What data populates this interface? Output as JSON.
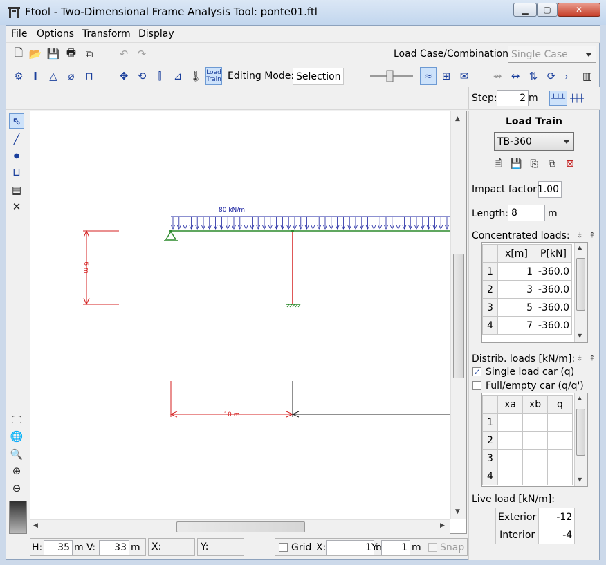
{
  "window": {
    "title": "Ftool - Two-Dimensional Frame Analysis Tool: ponte01.ftl",
    "controls": [
      "minimize-icon",
      "maximize-icon",
      "close-icon"
    ]
  },
  "menu": [
    "File",
    "Options",
    "Transform",
    "Display"
  ],
  "toolbar1": {
    "load_case_label": "Load Case/Combination:",
    "load_case_value": "Single Case"
  },
  "toolbar2": {
    "load_train_btn": [
      "Load",
      "Train"
    ],
    "editing_mode_label": "Editing Mode:",
    "editing_mode_value": "Selection"
  },
  "step": {
    "label": "Step:",
    "value": "2",
    "unit": "m"
  },
  "canvas": {
    "distributed_load_label": "80 kN/m",
    "height_dim_label": "6 m",
    "span_dim_label": "10 m",
    "colors": {
      "load": "#1a22a0",
      "member": "#d42020",
      "dimension": "#d42020",
      "support": "#2c8a2c"
    }
  },
  "status": {
    "h_label": "H:",
    "h_value": "35",
    "h_unit": "m",
    "v_label": "V:",
    "v_value": "33",
    "v_unit": "m",
    "x_label": "X:",
    "y_label": "Y:",
    "grid_label": "Grid",
    "grid_x_label": "X:",
    "grid_x_value": "1",
    "grid_x_unit": "m",
    "grid_y_label": "Y:",
    "grid_y_value": "1",
    "grid_y_unit": "m",
    "snap_label": "Snap"
  },
  "panel": {
    "title": "Load Train",
    "train_value": "TB-360",
    "impact_label": "Impact factor:",
    "impact_value": "1.00",
    "length_label": "Length:",
    "length_value": "8",
    "length_unit": "m",
    "concentrated_label": "Concentrated loads:",
    "conc_headers": [
      "x[m]",
      "P[kN]"
    ],
    "conc_rows": [
      {
        "n": "1",
        "x": "1",
        "p": "-360.0"
      },
      {
        "n": "2",
        "x": "3",
        "p": "-360.0"
      },
      {
        "n": "3",
        "x": "5",
        "p": "-360.0"
      },
      {
        "n": "4",
        "x": "7",
        "p": "-360.0"
      }
    ],
    "distrib_label": "Distrib. loads [kN/m]:",
    "single_car_label": "Single load car (q)",
    "single_car_checked": true,
    "full_empty_label": "Full/empty car (q/q')",
    "full_empty_checked": false,
    "distrib_headers": [
      "xa",
      "xb",
      "q"
    ],
    "distrib_rows": [
      "1",
      "2",
      "3",
      "4"
    ],
    "live_label": "Live load [kN/m]:",
    "live_rows": [
      {
        "name": "Exterior",
        "value": "-12"
      },
      {
        "name": "Interior",
        "value": "-4"
      }
    ]
  }
}
